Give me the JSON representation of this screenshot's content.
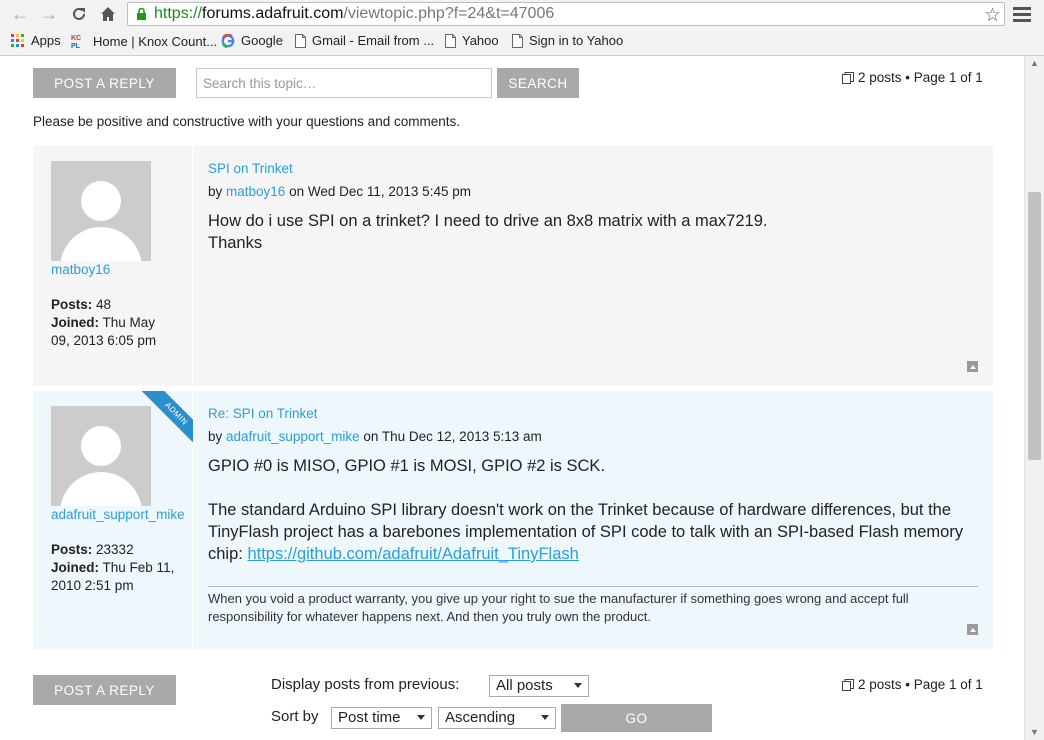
{
  "browser": {
    "url_scheme": "https://",
    "url_host": "forums.adafruit.com",
    "url_rest": "/viewtopic.php?f=24&t=47006",
    "bookmarks": [
      {
        "label": "Apps",
        "icon": "apps-grid-icon"
      },
      {
        "label": "Home | Knox Count...",
        "icon": "kcpl-favicon-icon"
      },
      {
        "label": "Google",
        "icon": "google-g-icon"
      },
      {
        "label": "Gmail - Email from ...",
        "icon": "page-icon"
      },
      {
        "label": "Yahoo",
        "icon": "page-icon"
      },
      {
        "label": "Sign in to Yahoo",
        "icon": "page-icon"
      }
    ]
  },
  "topbar": {
    "post_reply_label": "Post a reply",
    "search_placeholder": "Search this topic…",
    "search_label": "Search",
    "pagination": "2 posts • Page 1 of 1"
  },
  "notice": "Please be positive and constructive with your questions and comments.",
  "posts": [
    {
      "username": "matboy16",
      "posts_label": "Posts:",
      "posts_count": "48",
      "joined_label": "Joined:",
      "joined_line1": "Thu May",
      "joined_line2": "09, 2013 6:05 pm",
      "title": "SPI on Trinket",
      "by": "by",
      "author": "matboy16",
      "date": "on Wed Dec 11, 2013 5:45 pm",
      "body_line1": "How do i use SPI on a trinket? I need to drive an 8x8 matrix with a max7219.",
      "body_line2": "Thanks"
    },
    {
      "badge": "ADMIN",
      "username": "adafruit_support_mike",
      "posts_label": "Posts:",
      "posts_count": "23332",
      "joined_label": "Joined:",
      "joined_line1": "Thu Feb 11,",
      "joined_line2": "2010 2:51 pm",
      "title": "Re: SPI on Trinket",
      "by": "by",
      "author": "adafruit_support_mike",
      "date": "on Thu Dec 12, 2013 5:13 am",
      "body_line1": "GPIO #0 is MISO, GPIO #1 is MOSI, GPIO #2 is SCK.",
      "body_para2": "The standard Arduino SPI library doesn't work on the Trinket because of hardware differences, but the TinyFlash project has a barebones implementation of SPI code to talk with an SPI-based Flash memory chip: ",
      "body_link": "https://github.com/adafruit/Adafruit_TinyFlash",
      "signature": "When you void a product warranty, you give up your right to sue the manufacturer if something goes wrong and accept full responsibility for whatever happens next. And then you truly own the product."
    }
  ],
  "bottombar": {
    "post_reply_label": "Post a reply",
    "display_label": "Display posts from previous:",
    "display_value": "All posts",
    "sort_label": "Sort by",
    "sort_value": "Post time",
    "order_value": "Ascending",
    "go_label": "Go",
    "pagination": "2 posts • Page 1 of 1"
  }
}
